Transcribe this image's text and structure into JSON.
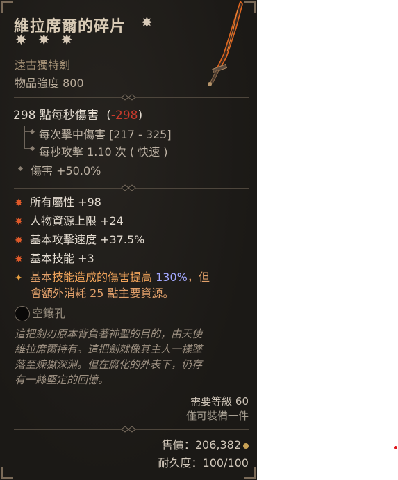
{
  "item": {
    "name": "維拉席爾的碎片",
    "type": "遠古獨特劍",
    "item_power": "物品強度 800",
    "dps_value": "298 點每秒傷害",
    "dps_paren_open": "(",
    "dps_delta": "-298",
    "dps_paren_close": ")",
    "damage_per_hit": "每次擊中傷害 [217 - 325]",
    "attacks_per_second": "每秒攻擊 1.10 次 ( 快速 )",
    "damage_bonus": "傷害 +50.0%",
    "affixes": [
      "所有屬性 +98",
      "人物資源上限 +24",
      "基本攻擊速度 +37.5%",
      "基本技能 +3"
    ],
    "unique_power": {
      "part1": "基本",
      "part2": "技能造成的傷害提高 ",
      "part3": "130%",
      "part4": "，但",
      "line2": "會額外消耗 25 點主要資源。"
    },
    "socket_label": "空鑲孔",
    "flavor_text": [
      "這把劍刃原本背負著神聖的目的，由天使",
      "維拉席爾持有。這把劍就像其主人一樣墜",
      "落至煉獄深淵。但在腐化的外表下，仍存",
      "有一絲堅定的回憶。"
    ],
    "required_level": "需要等級 60",
    "equip_limit": "僅可裝備一件",
    "sell_price": "售價：206,382",
    "durability": "耐久度：100/100"
  },
  "colors": {
    "background": "#1c1a17",
    "negative": "#c83a2c",
    "unique_text": "#e1a06a",
    "highlight_blue": "#a3a8ff",
    "bullet": "#e05a2a"
  },
  "icons": [
    "flower-star-icon",
    "sword-icon",
    "bullet-icon",
    "socket-icon",
    "gold-coin-icon"
  ]
}
